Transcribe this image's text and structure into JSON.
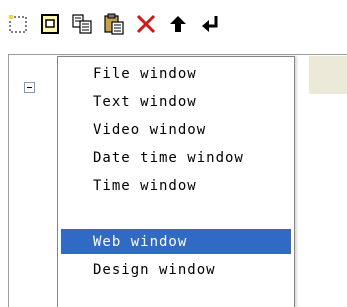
{
  "toolbar": {
    "buttons": [
      {
        "name": "new",
        "icon": "new-dotted-icon"
      },
      {
        "name": "add-window",
        "icon": "add-window-icon"
      },
      {
        "name": "copy",
        "icon": "copy-icon"
      },
      {
        "name": "paste",
        "icon": "paste-icon"
      },
      {
        "name": "delete",
        "icon": "delete-x-icon"
      },
      {
        "name": "move-up",
        "icon": "arrow-up-icon"
      },
      {
        "name": "move-back",
        "icon": "arrow-return-icon"
      }
    ]
  },
  "tree": {
    "expander_icon": "collapse-minus-icon"
  },
  "menu": {
    "items": [
      {
        "label": "File window",
        "selected": false
      },
      {
        "label": "Text window",
        "selected": false
      },
      {
        "label": "Video window",
        "selected": false
      },
      {
        "label": "Date time window",
        "selected": false
      },
      {
        "label": "Time window",
        "selected": false
      },
      {
        "label": "Web window",
        "selected": true
      },
      {
        "label": "Design window",
        "selected": false
      }
    ]
  },
  "colors": {
    "selection": "#316ac5",
    "delete": "#cc1a1a",
    "frame": "#ece9d8"
  }
}
